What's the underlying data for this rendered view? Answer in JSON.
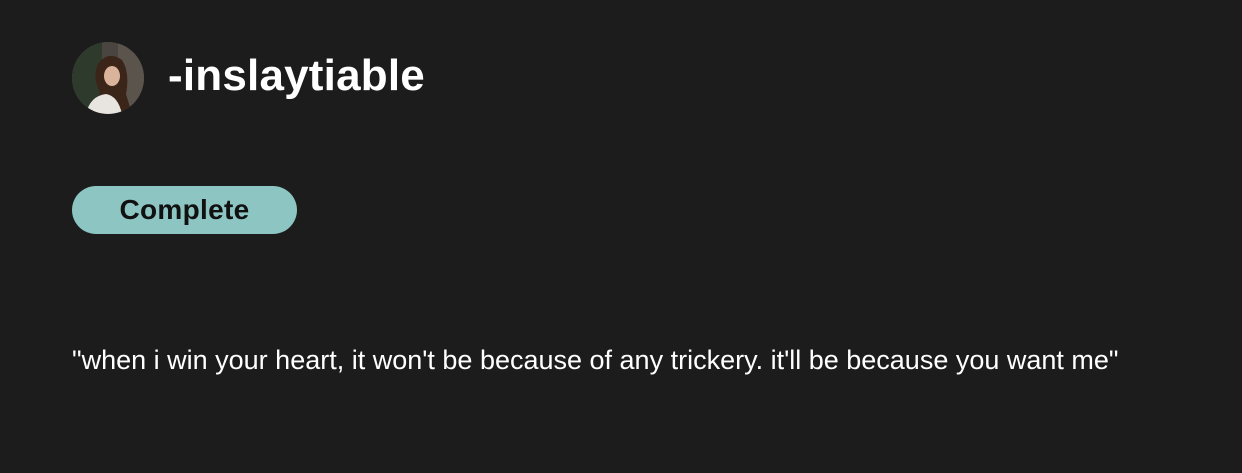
{
  "story": {
    "author": {
      "username": "-inslaytiable",
      "avatar_icon": "profile-photo"
    },
    "status": {
      "label": "Complete",
      "color": "#8cc5c2"
    },
    "description": "\"when i win your heart, it won't be because of any trickery.  it'll be because you want me\""
  }
}
